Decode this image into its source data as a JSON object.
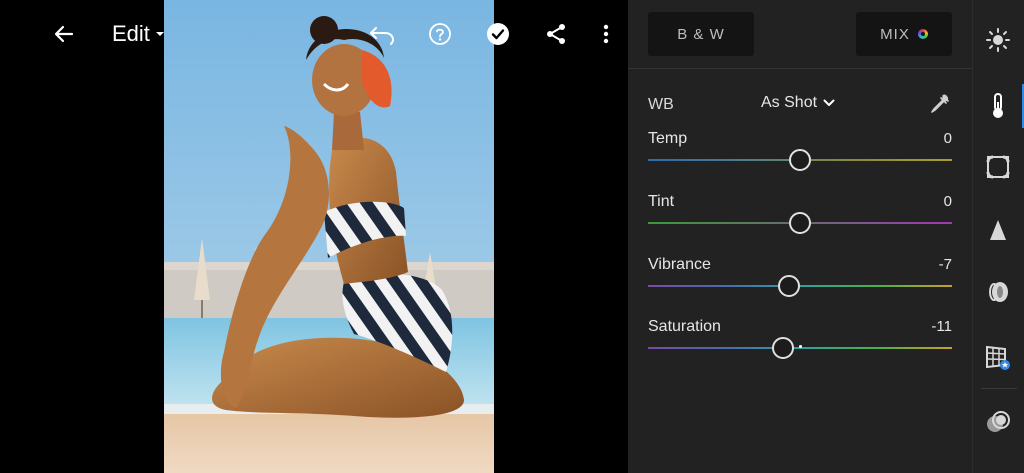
{
  "topbar": {
    "edit_label": "Edit"
  },
  "panel": {
    "bw_label": "B & W",
    "mix_label": "MIX",
    "wb": {
      "label": "WB",
      "value": "As Shot"
    },
    "sliders": [
      {
        "label": "Temp",
        "value": "0",
        "position": 0.5
      },
      {
        "label": "Tint",
        "value": "0",
        "position": 0.5
      },
      {
        "label": "Vibrance",
        "value": "-7",
        "position": 0.465
      },
      {
        "label": "Saturation",
        "value": "-11",
        "position": 0.445
      }
    ]
  },
  "rail": {
    "tools": [
      "light-icon",
      "color-icon",
      "effects-icon",
      "detail-icon",
      "optics-icon",
      "geometry-icon",
      "presets-icon"
    ],
    "active_tool": "color-icon"
  },
  "colors": {
    "panel_bg": "#222222",
    "button_bg": "#141414",
    "accent": "#2d8cea",
    "sky": "#8cc3e6"
  }
}
